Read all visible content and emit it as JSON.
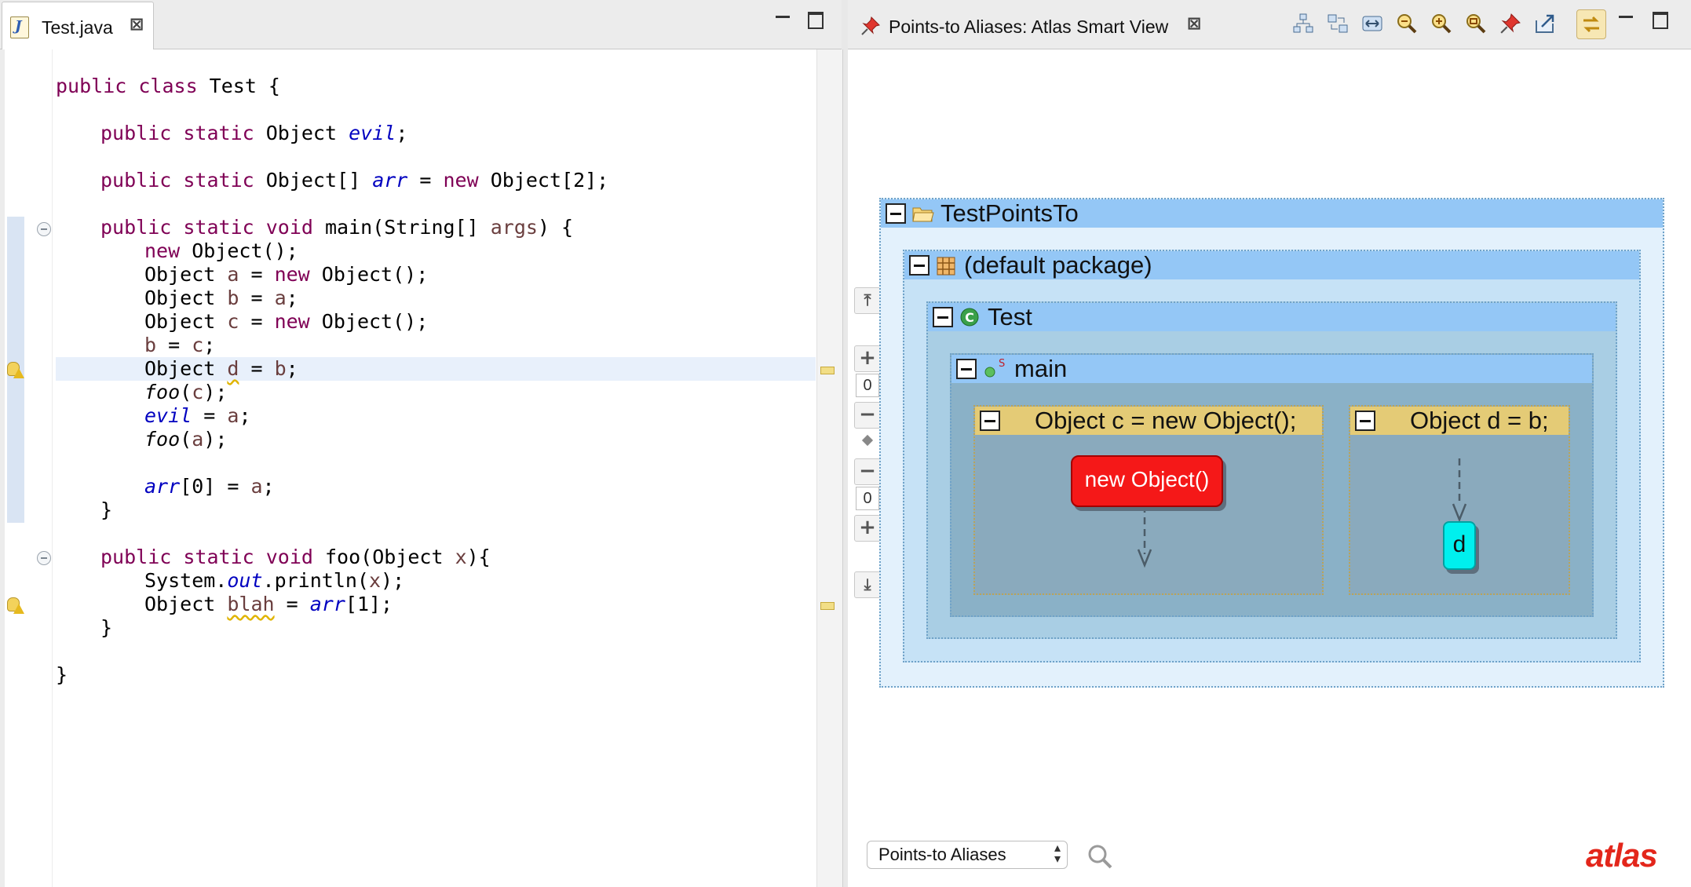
{
  "editor": {
    "tab_label": "Test.java",
    "close_glyph": "⊠",
    "lines": [
      {
        "t": "public class Test {"
      },
      {
        "t": "public static Object evil;"
      },
      {
        "t": "public static Object[] arr = new Object[2];"
      },
      {
        "t": "public static void main(String[] args) {"
      },
      {
        "t": "new Object();"
      },
      {
        "t": "Object a = new Object();"
      },
      {
        "t": "Object b = a;"
      },
      {
        "t": "Object c = new Object();"
      },
      {
        "t": "b = c;"
      },
      {
        "t": "Object d = b;"
      },
      {
        "t": "foo(c);"
      },
      {
        "t": "evil = a;"
      },
      {
        "t": "foo(a);"
      },
      {
        "t": "arr[0] = a;"
      },
      {
        "t": "}"
      },
      {
        "t": "public static void foo(Object x){"
      },
      {
        "t": "System.out.println(x);"
      },
      {
        "t": "Object blah = arr[1];"
      },
      {
        "t": "}"
      },
      {
        "t": "}"
      }
    ]
  },
  "atlas": {
    "tab_label": "Points-to Aliases: Atlas Smart View",
    "close_glyph": "⊠",
    "toolbar_icons": [
      "hierarchy-layout-icon",
      "swap-layout-icon",
      "fit-width-icon",
      "zoom-out-icon",
      "zoom-in-icon",
      "zoom-fit-icon",
      "pin-icon",
      "export-icon",
      "link-with-editor-icon"
    ],
    "zoom": {
      "top_value": "0",
      "bottom_value": "0"
    },
    "graph": {
      "project": "TestPointsTo",
      "package": "(default package)",
      "class": "Test",
      "method": "main",
      "stmt_c": "Object c = new Object();",
      "stmt_d": "Object d = b;",
      "node_new": "new Object()",
      "node_d": "d"
    },
    "view_selector": "Points-to Aliases",
    "logo": "atlas",
    "colors": {
      "group_header": "#94c7f6",
      "stmt_header": "#e4cb76",
      "node_new": "#f51818",
      "node_d": "#00f0ee"
    }
  }
}
